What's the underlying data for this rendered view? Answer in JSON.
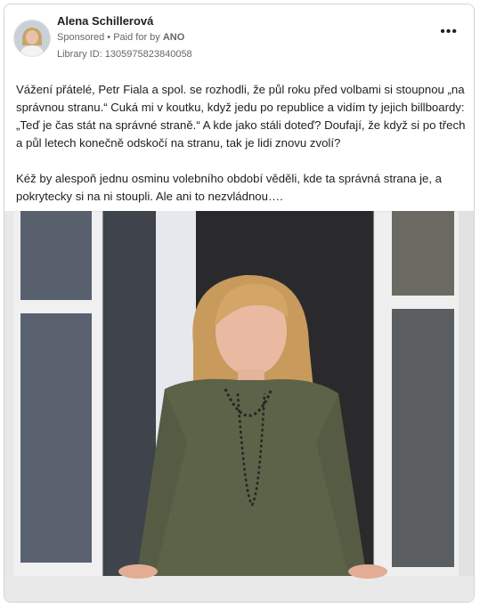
{
  "post": {
    "author": "Alena Schillerová",
    "sponsored": "Sponsored",
    "separator": "•",
    "paid_for_prefix": "Paid for by",
    "paid_for_by": "ANO",
    "library_id": "Library ID: 1305975823840058",
    "more_icon": "more-horizontal-icon",
    "paragraphs": [
      "Vážení přátelé, Petr Fiala a spol. se rozhodli, že půl roku před volbami si stoupnou „na správnou stranu.“ Cuká mi v koutku, když jedu po republice a vidím ty jejich billboardy: „Teď je čas stát na správné straně.“ A kde jako stáli doteď? Doufají, že když si po třech a půl letech konečně odskočí na stranu, tak je lidi znovu zvolí?",
      "Kéž by alespoň jednu osminu volebního období věděli, kde ta správná strana je, a pokrytecky si na ni stoupli. Ale ani to nezvládnou…."
    ]
  },
  "colors": {
    "text": "#1c1e21",
    "secondary": "#65676b",
    "border": "#d0d3d8",
    "dress": "#5c6349"
  }
}
